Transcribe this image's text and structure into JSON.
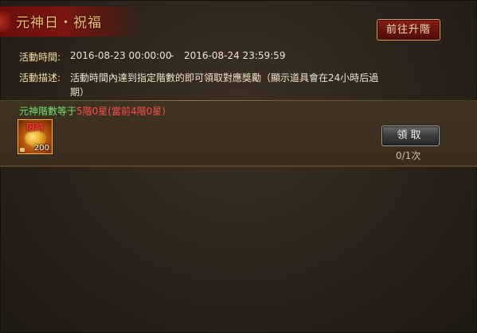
{
  "title": "元神日・祝福",
  "header": {
    "upgrade_button": "前往升階"
  },
  "info": {
    "time_label": "活動時間:",
    "time_start": "2016-08-23 00:00:00",
    "time_sep": "-",
    "time_end": "2016-08-24 23:59:59",
    "desc_label": "活動描述:",
    "desc_line1": "活動時間內達到指定階數的即可領取對應獎勵（顯示道具會在24小時后過",
    "desc_line2": "期）"
  },
  "reward": {
    "condition_prefix": "元神階數等于",
    "condition_target": "5階0星(當前4階0星)",
    "item_tag": "限時",
    "item_count": "200",
    "item_icon": "gold-coin-icon",
    "claim_button": "領取",
    "progress": "0/1次"
  },
  "colors": {
    "title": "#f6c36b",
    "condition_green": "#6fe36a",
    "condition_red": "#ff4d4d",
    "banner_red": "#7c1510"
  }
}
